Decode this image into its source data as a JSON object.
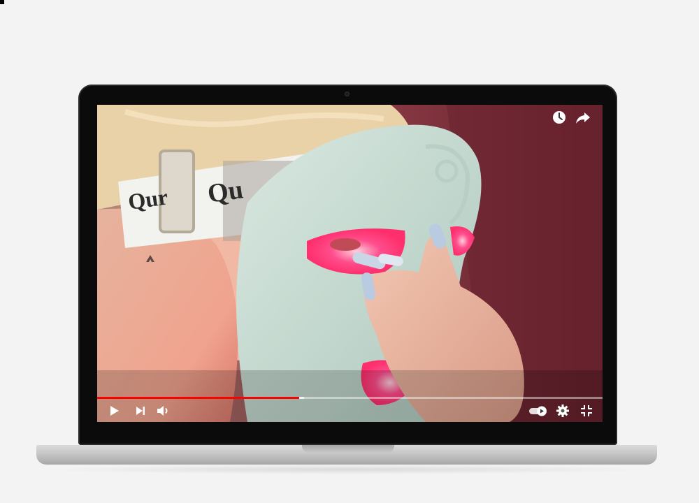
{
  "video": {
    "progress_fraction": 0.4,
    "buffered_fraction": 0.41
  },
  "player": {
    "top_controls": [
      "watch-later-icon",
      "share-icon"
    ],
    "bottom_left_controls": [
      "play-icon",
      "next-icon",
      "volume-icon"
    ],
    "bottom_right_controls": [
      "autoplay-toggle",
      "settings-icon",
      "exit-fullscreen-icon"
    ],
    "autoplay_on": true
  },
  "scene": {
    "strap_text_1": "Qur",
    "strap_text_2": "Qu"
  },
  "colors": {
    "progress": "#ff0000",
    "background": "#f3f3f3",
    "mask": "#c9ddd3",
    "led_glow": "#ff4d8c"
  }
}
